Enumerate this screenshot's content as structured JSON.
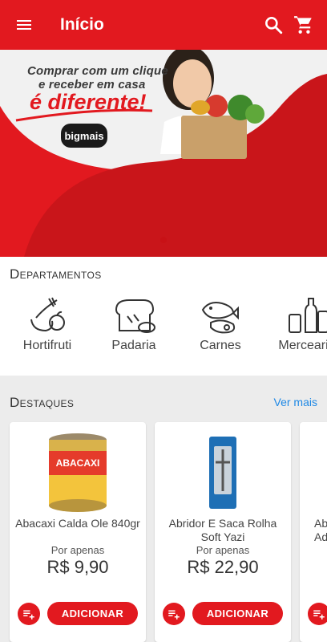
{
  "appbar": {
    "title": "Início",
    "menu_icon": "menu-icon",
    "search_icon": "search-icon",
    "cart_icon": "cart-icon",
    "color": "#e2191f"
  },
  "banner": {
    "line1": "Comprar com um clique",
    "line2": "e receber em casa",
    "tagline": "é diferente!",
    "brand": "bigmais",
    "active_slide": 1
  },
  "departments": {
    "title": "Departamentos",
    "items": [
      {
        "label": "Hortifruti",
        "icon": "produce-icon"
      },
      {
        "label": "Padaria",
        "icon": "bread-icon"
      },
      {
        "label": "Carnes",
        "icon": "meat-icon"
      },
      {
        "label": "Mercearia",
        "icon": "grocery-icon"
      }
    ]
  },
  "highlights": {
    "title": "Destaques",
    "see_more": "Ver mais",
    "products": [
      {
        "name": "Abacaxi Calda Ole 840gr",
        "price_prefix": "Por apenas",
        "price": "R$ 9,90",
        "add_label": "ADICIONAR"
      },
      {
        "name": "Abridor E Saca Rolha Soft Yazi",
        "price_prefix": "Por apenas",
        "price": "R$ 22,90",
        "add_label": "ADICIONAR"
      },
      {
        "name": "Ab Adp",
        "price_prefix": "",
        "price": "",
        "add_label": ""
      }
    ]
  }
}
